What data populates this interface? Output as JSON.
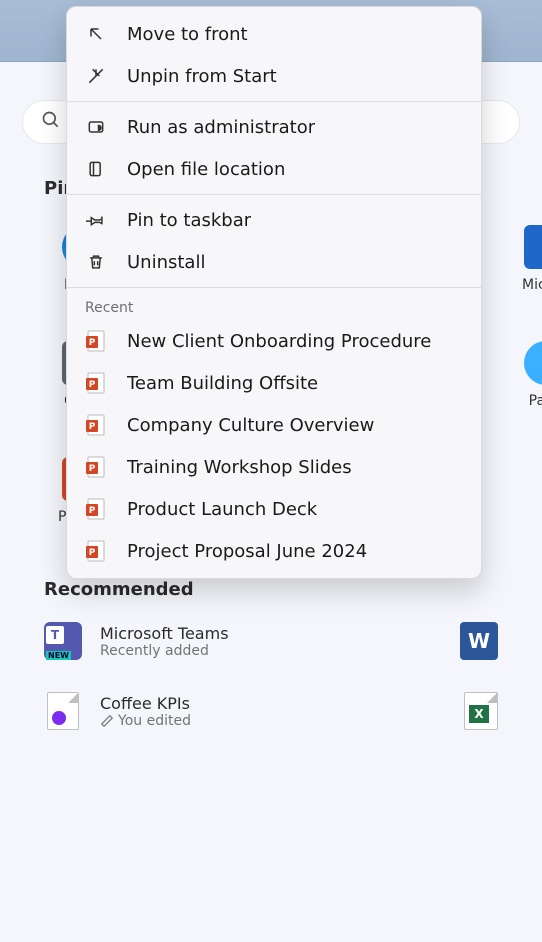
{
  "context_menu": {
    "actions": [
      {
        "name": "move-to-front",
        "label": "Move to front",
        "icon": "arrow-upleft-icon"
      },
      {
        "name": "unpin-from-start",
        "label": "Unpin from Start",
        "icon": "unpin-icon"
      }
    ],
    "admin": [
      {
        "name": "run-as-admin",
        "label": "Run as administrator",
        "icon": "shield-icon"
      },
      {
        "name": "open-file-location",
        "label": "Open file location",
        "icon": "folder-open-icon"
      }
    ],
    "more": [
      {
        "name": "pin-to-taskbar",
        "label": "Pin to taskbar",
        "icon": "pin-icon"
      },
      {
        "name": "uninstall",
        "label": "Uninstall",
        "icon": "trash-icon"
      }
    ],
    "recent_header": "Recent",
    "recent": [
      {
        "label": "New Client Onboarding Procedure"
      },
      {
        "label": "Team Building Offsite"
      },
      {
        "label": "Company Culture Overview"
      },
      {
        "label": "Training Workshop Slides"
      },
      {
        "label": "Product Launch Deck"
      },
      {
        "label": "Project Proposal June 2024"
      }
    ]
  },
  "start": {
    "pinned_header": "Pinned",
    "pinned": {
      "edge": "Edge",
      "store": "Microsoft Store",
      "calc": "Calculator",
      "paint": "Paint",
      "ppt": "PowerPoint"
    },
    "recommended_header": "Recommended",
    "recommended": [
      {
        "title": "Microsoft Teams",
        "sub": "Recently added",
        "icon": "teams"
      },
      {
        "title": "Coffee KPIs",
        "sub": "You edited",
        "icon": "onenote-doc"
      }
    ],
    "right_icons": {
      "word": "W",
      "excel": "X"
    }
  }
}
